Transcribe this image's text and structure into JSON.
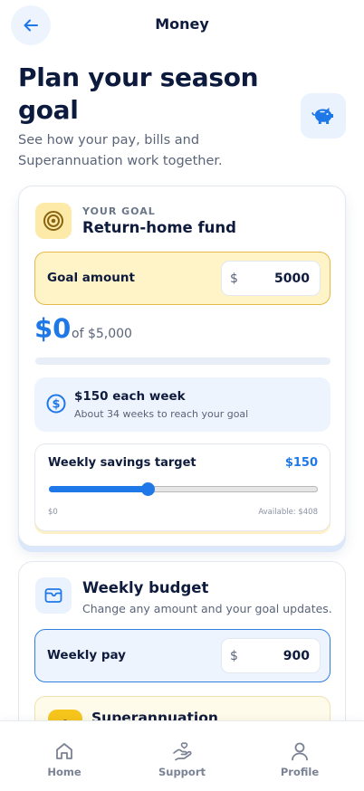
{
  "header": {
    "title": "Money",
    "back_icon": "arrow-left-icon"
  },
  "page": {
    "title": "Plan your season goal",
    "subtitle": "See how your pay, bills and Superannuation work together.",
    "piggy_icon": "piggy-bank-icon"
  },
  "goal": {
    "eyebrow": "YOUR GOAL",
    "name": "Return-home fund",
    "amount_label": "Goal amount",
    "currency_symbol": "$",
    "amount_value": "5000",
    "saved_display": "$0",
    "of_display": "of $5,000",
    "progress_fraction": 0,
    "weekly_title": "$150 each week",
    "weekly_subtitle": "About 34 weeks to reach your goal",
    "slider": {
      "label": "Weekly savings target",
      "value_display": "$150",
      "value": 150,
      "min": 0,
      "max": 408,
      "min_label": "$0",
      "max_label": "Available: $408"
    }
  },
  "budget": {
    "title": "Weekly budget",
    "subtitle": "Change any amount and your goal updates.",
    "pay_label": "Weekly pay",
    "currency_symbol": "$",
    "pay_value": "900",
    "super_title": "Superannuation"
  },
  "nav": {
    "items": [
      {
        "label": "Home",
        "icon": "home-icon"
      },
      {
        "label": "Support",
        "icon": "support-hand-icon"
      },
      {
        "label": "Profile",
        "icon": "profile-icon"
      }
    ]
  },
  "colors": {
    "accent": "#1f78e8",
    "text_dark": "#0f1b3d",
    "goal_highlight": "#fff3c8",
    "goal_border": "#e3b94a",
    "super_yellow": "#f6c51c"
  }
}
